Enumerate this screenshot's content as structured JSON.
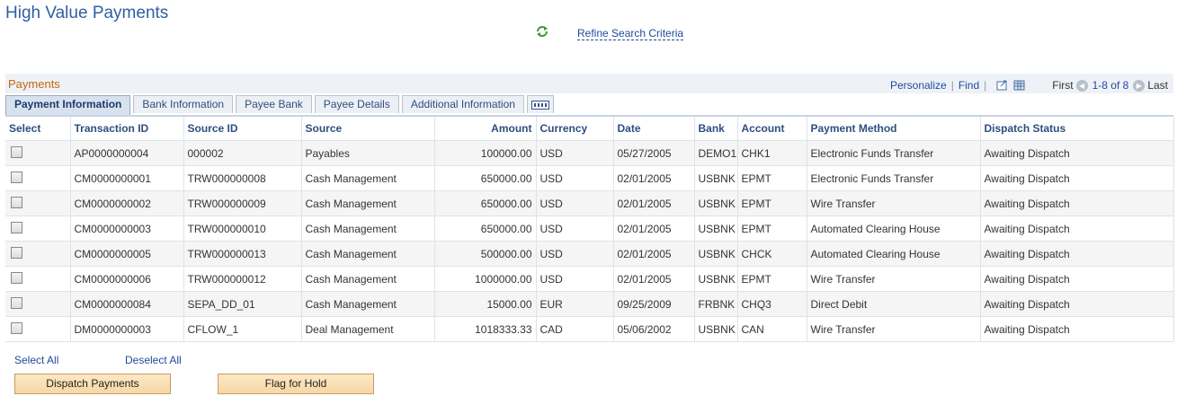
{
  "page": {
    "title": "High Value Payments"
  },
  "toolbar": {
    "refine_label": "Refine Search Criteria",
    "refresh_icon": "refresh-icon"
  },
  "grid": {
    "title": "Payments",
    "personalize": "Personalize",
    "find": "Find",
    "first": "First",
    "range": "1-8 of 8",
    "last": "Last"
  },
  "tabs": [
    {
      "label": "Payment Information",
      "active": true
    },
    {
      "label": "Bank Information"
    },
    {
      "label": "Payee Bank"
    },
    {
      "label": "Payee Details"
    },
    {
      "label": "Additional Information"
    }
  ],
  "columns": [
    "Select",
    "Transaction ID",
    "Source ID",
    "Source",
    "Amount",
    "Currency",
    "Date",
    "Bank",
    "Account",
    "Payment Method",
    "Dispatch Status"
  ],
  "rows": [
    {
      "transaction_id": "AP0000000004",
      "source_id": "000002",
      "source": "Payables",
      "amount": "100000.00",
      "currency": "USD",
      "date": "05/27/2005",
      "bank": "DEMO1",
      "account": "CHK1",
      "method": "Electronic Funds Transfer",
      "status": "Awaiting Dispatch"
    },
    {
      "transaction_id": "CM0000000001",
      "source_id": "TRW000000008",
      "source": "Cash Management",
      "amount": "650000.00",
      "currency": "USD",
      "date": "02/01/2005",
      "bank": "USBNK",
      "account": "EPMT",
      "method": "Electronic Funds Transfer",
      "status": "Awaiting Dispatch"
    },
    {
      "transaction_id": "CM0000000002",
      "source_id": "TRW000000009",
      "source": "Cash Management",
      "amount": "650000.00",
      "currency": "USD",
      "date": "02/01/2005",
      "bank": "USBNK",
      "account": "EPMT",
      "method": "Wire Transfer",
      "status": "Awaiting Dispatch"
    },
    {
      "transaction_id": "CM0000000003",
      "source_id": "TRW000000010",
      "source": "Cash Management",
      "amount": "650000.00",
      "currency": "USD",
      "date": "02/01/2005",
      "bank": "USBNK",
      "account": "EPMT",
      "method": "Automated Clearing House",
      "status": "Awaiting Dispatch"
    },
    {
      "transaction_id": "CM0000000005",
      "source_id": "TRW000000013",
      "source": "Cash Management",
      "amount": "500000.00",
      "currency": "USD",
      "date": "02/01/2005",
      "bank": "USBNK",
      "account": "CHCK",
      "method": "Automated Clearing House",
      "status": "Awaiting Dispatch"
    },
    {
      "transaction_id": "CM0000000006",
      "source_id": "TRW000000012",
      "source": "Cash Management",
      "amount": "1000000.00",
      "currency": "USD",
      "date": "02/01/2005",
      "bank": "USBNK",
      "account": "EPMT",
      "method": "Wire Transfer",
      "status": "Awaiting Dispatch"
    },
    {
      "transaction_id": "CM0000000084",
      "source_id": "SEPA_DD_01",
      "source": "Cash Management",
      "amount": "15000.00",
      "currency": "EUR",
      "date": "09/25/2009",
      "bank": "FRBNK",
      "account": "CHQ3",
      "method": "Direct Debit",
      "status": "Awaiting Dispatch"
    },
    {
      "transaction_id": "DM0000000003",
      "source_id": "CFLOW_1",
      "source": "Deal Management",
      "amount": "1018333.33",
      "currency": "CAD",
      "date": "05/06/2002",
      "bank": "USBNK",
      "account": "CAN",
      "method": "Wire Transfer",
      "status": "Awaiting Dispatch"
    }
  ],
  "actions": {
    "select_all": "Select All",
    "deselect_all": "Deselect All",
    "dispatch": "Dispatch Payments",
    "hold": "Flag for Hold"
  }
}
